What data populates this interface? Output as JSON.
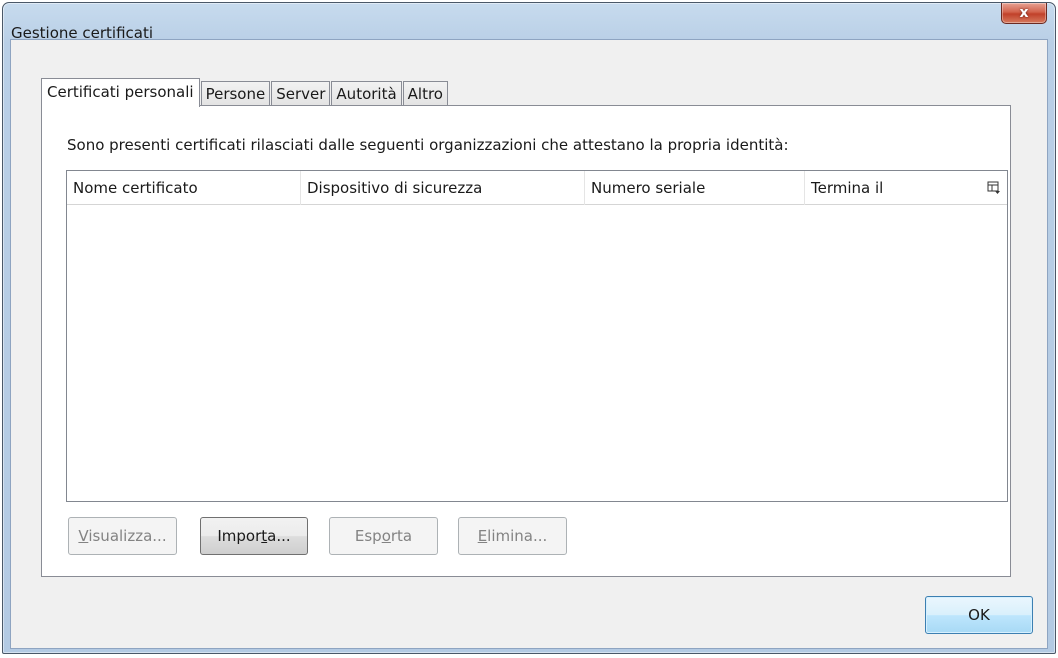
{
  "window": {
    "title": "Gestione certificati",
    "close_label": "x"
  },
  "tabs": [
    {
      "label": "Certificati personali",
      "active": true
    },
    {
      "label": "Persone",
      "active": false
    },
    {
      "label": "Server",
      "active": false
    },
    {
      "label": "Autorità",
      "active": false
    },
    {
      "label": "Altro",
      "active": false
    }
  ],
  "panel": {
    "description": "Sono presenti certificati rilasciati dalle seguenti organizzazioni che attestano la propria identità:"
  },
  "table": {
    "columns": [
      "Nome certificato",
      "Dispositivo di sicurezza",
      "Numero seriale",
      "Termina il"
    ],
    "rows": [],
    "column_picker_icon": "column-picker-icon"
  },
  "buttons": {
    "view": {
      "before": "",
      "mnemonic": "V",
      "after": "isualizza...",
      "enabled": false
    },
    "import": {
      "before": "Impor",
      "mnemonic": "t",
      "after": "a...",
      "enabled": true
    },
    "export": {
      "before": "Esp",
      "mnemonic": "o",
      "after": "rta",
      "enabled": false
    },
    "delete": {
      "before": "",
      "mnemonic": "E",
      "after": "limina...",
      "enabled": false
    },
    "ok": "OK"
  },
  "colors": {
    "title_gradient_top": "#c7dbee",
    "close_red": "#c1412a",
    "ok_blue": "#a7d9f5"
  }
}
